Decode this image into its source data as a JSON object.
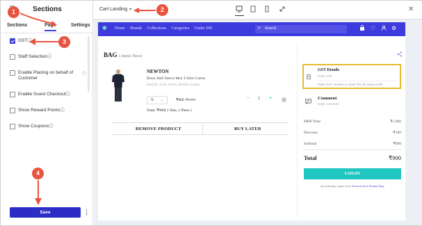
{
  "sidebar": {
    "title": "Sections",
    "tabs": [
      {
        "label": "Sections"
      },
      {
        "label": "Page"
      },
      {
        "label": "Settings"
      }
    ],
    "options": [
      {
        "label": "GST",
        "checked": true,
        "info": "ⓘ"
      },
      {
        "label": "Staff Selection",
        "checked": false,
        "info": "ⓘ"
      },
      {
        "label": "Enable Placing on behalf of Customer",
        "checked": false,
        "info": "ⓘ"
      },
      {
        "label": "Enable Guest Checkout",
        "checked": false,
        "info": "ⓘ"
      },
      {
        "label": "Show Reward Points",
        "checked": false,
        "info": "ⓘ"
      },
      {
        "label": "Show Coupons",
        "checked": false,
        "info": "ⓘ"
      }
    ],
    "save_label": "Save",
    "more_label": "⋮"
  },
  "topbar": {
    "page_name": "Cart Landing",
    "caret": "▾"
  },
  "store": {
    "nav": [
      "Home",
      "Brands",
      "Collections",
      "Categories",
      "Under 500"
    ],
    "search_placeholder": "Search",
    "bag_title": "BAG",
    "bag_count": "1 Item(1 Piece)",
    "product": {
      "brand": "NEWTON",
      "name": "Black Half Sleeve Men T-Shirt Cotton",
      "meta": "Sold By: Lime Arrow, Mobile: Ladies",
      "size": "S",
      "price": "₹900",
      "mrp": "₹1000",
      "quantity": "1",
      "total": "Total: ₹900( 1 Size, 1 Piece )"
    },
    "remove_label": "REMOVE PRODUCT",
    "buy_later_label": "BUY LATER",
    "gst": {
      "title": "GST Details",
      "subtitle": "Enter GST",
      "note": "Enter GST number to claim ₹41.30 input credit"
    },
    "comment": {
      "title": "Comment",
      "subtitle": "Enter comment"
    },
    "summary": {
      "mrp_label": "MRP Total",
      "mrp_value": "₹1,000",
      "discount_label": "Discount",
      "discount_value": "-₹100",
      "subtotal_label": "Subtotal",
      "subtotal_value": "₹900",
      "total_label": "Total",
      "total_value": "₹900"
    },
    "login_label": "LOGIN",
    "terms_prefix": "By continuing, I agree to the",
    "terms_link": "Terms of Use & Privacy Policy"
  },
  "annotations": [
    "1",
    "2",
    "3",
    "4"
  ],
  "colors": {
    "accent": "#3d3ade",
    "save": "#2c2cc7",
    "callout": "#e8543f",
    "highlight": "#e8b92c",
    "login": "#20c7c1"
  }
}
